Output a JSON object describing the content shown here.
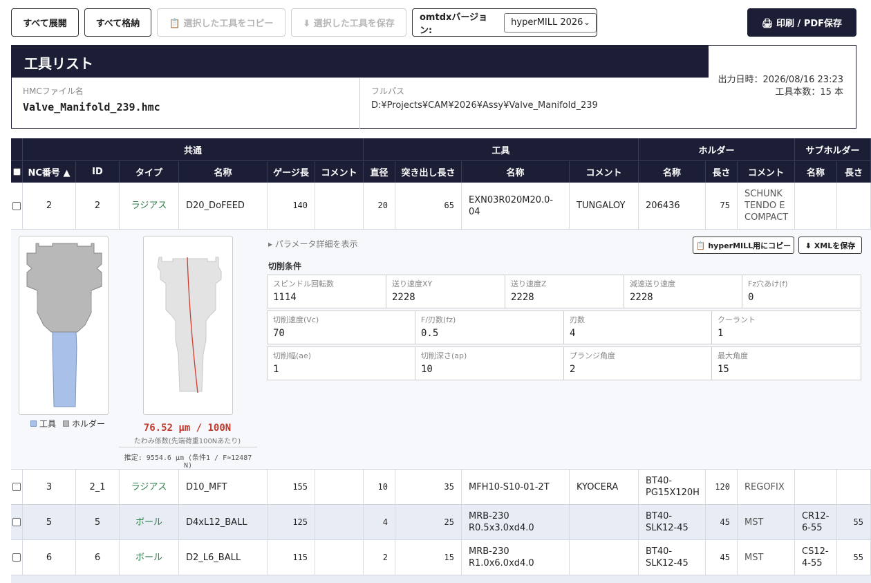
{
  "toolbar": {
    "expand_all": "すべて展開",
    "collapse_all": "すべて格納",
    "copy_selected": "📋 選択した工具をコピー",
    "save_selected": "⬇ 選択した工具を保存",
    "version_label": "omtdxバージョン:",
    "version_value": "hyperMILL 2026",
    "print": "🖨 印刷 / PDF保存"
  },
  "header": {
    "title": "工具リスト",
    "file_label": "HMCファイル名",
    "file_value": "Valve_Manifold_239.hmc",
    "path_label": "フルパス",
    "path_value": "D:¥Projects¥CAM¥2026¥Assy¥Valve_Manifold_239",
    "output_date": "出力日時：2026/08/16 23:23",
    "tool_count": "工具本数：15 本"
  },
  "table": {
    "groups": [
      "共通",
      "工具",
      "ホルダー",
      "サブホルダー"
    ],
    "columns": [
      "NC番号 ▲",
      "ID",
      "タイプ",
      "名称",
      "ゲージ長",
      "コメント",
      "直径",
      "突き出し長さ",
      "名称",
      "コメント",
      "名称",
      "長さ",
      "コメント",
      "名称",
      "長さ"
    ],
    "rows": [
      [
        "2",
        "2",
        "ラジアス",
        "D20_DoFEED",
        "140",
        "",
        "20",
        "65",
        "EXN03R020M20.0-04",
        "TUNGALOY",
        "206436",
        "75",
        "SCHUNK TENDO E COMPACT",
        "",
        ""
      ],
      [
        "3",
        "2_1",
        "ラジアス",
        "D10_MFT",
        "155",
        "",
        "10",
        "35",
        "MFH10-S10-01-2T",
        "KYOCERA",
        "BT40-PG15X120H",
        "120",
        "REGOFIX",
        "",
        ""
      ],
      [
        "5",
        "5",
        "ボール",
        "D4xL12_BALL",
        "125",
        "",
        "4",
        "25",
        "MRB-230 R0.5x3.0xd4.0",
        "",
        "BT40-SLK12-45",
        "45",
        "MST",
        "CR12-6-55",
        "55"
      ],
      [
        "6",
        "6",
        "ボール",
        "D2_L6_BALL",
        "115",
        "",
        "2",
        "15",
        "MRB-230 R1.0x6.0xd4.0",
        "",
        "BT40-SLK12-45",
        "45",
        "MST",
        "CS12-4-55",
        "55"
      ]
    ]
  },
  "detail": {
    "legend_tool": "工具",
    "legend_holder": "ホルダー",
    "legend_tool_color": "#a9c1e8",
    "legend_holder_color": "#b5b5b5",
    "deflection": "76.52 µm / 100N",
    "deflection_sub": "たわみ係数(先端荷重100Nあたり)",
    "estimate": "推定: 9554.6 µm (条件1 / F≈12487 N)",
    "param_toggle": "▸ パラメータ詳細を表示",
    "copy_hypermill": "📋 hyperMILL用にコピー",
    "save_xml": "⬇ XMLを保存",
    "section": "切削条件",
    "params_row1": [
      {
        "label": "スピンドル回転数",
        "value": "1114"
      },
      {
        "label": "送り速度XY",
        "value": "2228"
      },
      {
        "label": "送り速度Z",
        "value": "2228"
      },
      {
        "label": "減速送り速度",
        "value": "2228"
      },
      {
        "label": "Fz穴あけ(f)",
        "value": "0"
      }
    ],
    "params_row2": [
      {
        "label": "切削速度(Vc)",
        "value": "70"
      },
      {
        "label": "F/刃数(fz)",
        "value": "0.5"
      },
      {
        "label": "刃数",
        "value": "4"
      },
      {
        "label": "クーラント",
        "value": "1"
      }
    ],
    "params_row3": [
      {
        "label": "切削幅(ae)",
        "value": "1"
      },
      {
        "label": "切削深さ(ap)",
        "value": "10"
      },
      {
        "label": "プランジ角度",
        "value": "2"
      },
      {
        "label": "最大角度",
        "value": "15"
      }
    ]
  },
  "colors": {
    "header_bg": "#1c1e36",
    "type_green": "#2e7d4a",
    "deflection_red": "#c0392b"
  }
}
